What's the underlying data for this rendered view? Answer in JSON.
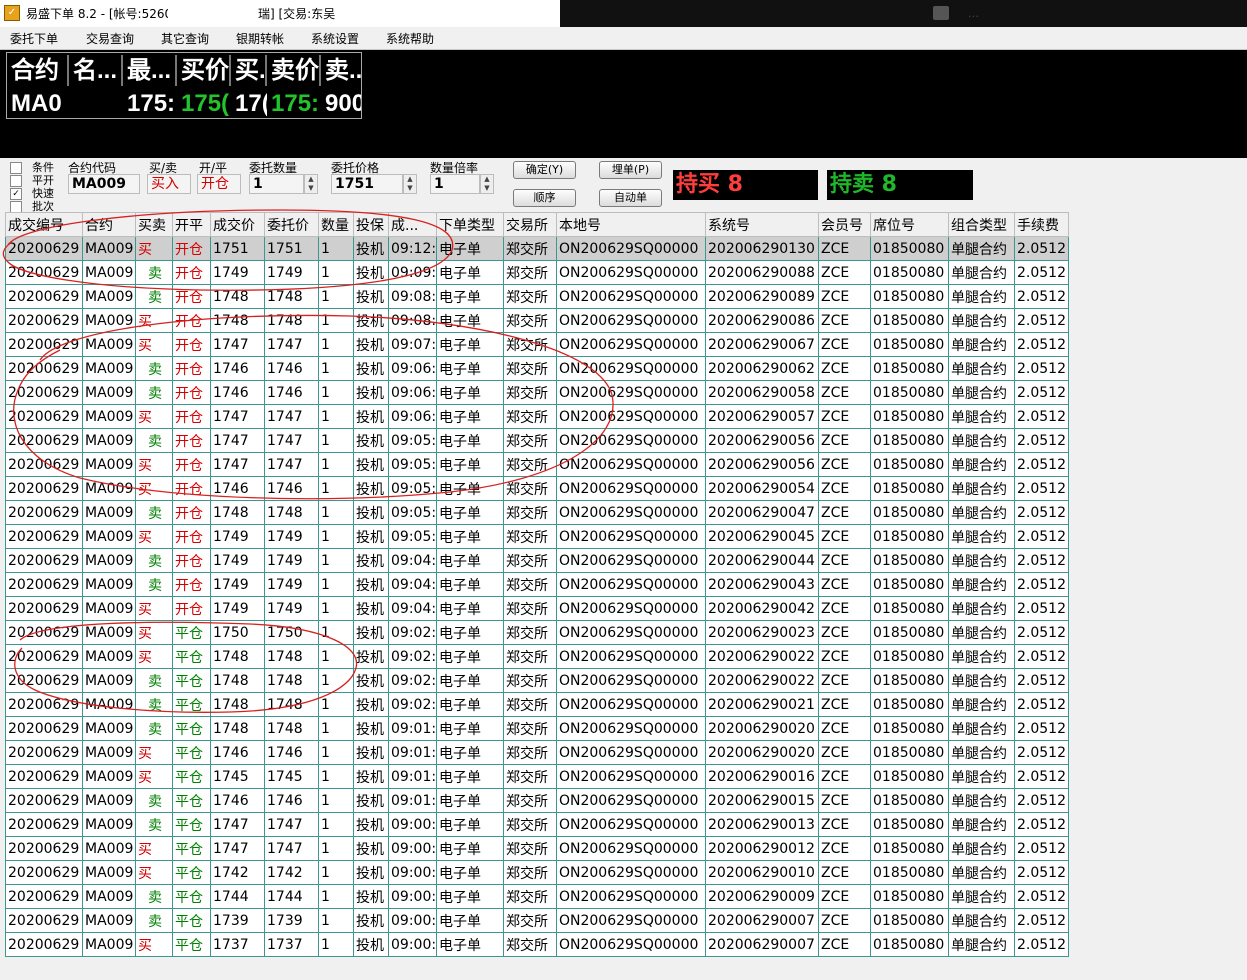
{
  "window": {
    "title_a": "易盛下单 8.2 - [帐号:5260",
    "title_b": "瑞] [交易:东吴",
    "right_text": "…"
  },
  "menu": [
    "委托下单",
    "交易查询",
    "其它查询",
    "银期转帐",
    "系统设置",
    "系统帮助"
  ],
  "quote": {
    "headers": [
      "合约",
      "名...",
      "最...",
      "买价",
      "买..",
      "卖价",
      "卖..."
    ],
    "values": [
      "MA0",
      "",
      "175:",
      "175(",
      "17(",
      "175:",
      "900"
    ]
  },
  "order_form": {
    "checkboxes": [
      {
        "label": "条件",
        "checked": false
      },
      {
        "label": "平开",
        "checked": false
      },
      {
        "label": "快速",
        "checked": true
      },
      {
        "label": "批次",
        "checked": false
      }
    ],
    "contract_label": "合约代码",
    "contract_value": "MA009",
    "side_label": "买/卖",
    "side_value": "买入",
    "oc_label": "开/平",
    "oc_value": "开仓",
    "qty_label": "委托数量",
    "qty_value": "1",
    "price_label": "委托价格",
    "price_value": "1751",
    "mult_label": "数量倍率",
    "mult_value": "1",
    "confirm_button": "确定(Y)",
    "sequence_button": "顺序",
    "park_button": "埋单(P)",
    "auto_button": "自动单",
    "hold_buy": "持买 8",
    "hold_sell": "持卖 8"
  },
  "table": {
    "headers": [
      "成交编号",
      "合约",
      "买卖",
      "开平",
      "成交价",
      "委托价",
      "数量",
      "投保",
      "成...",
      "下单类型",
      "交易所",
      "本地号",
      "系统号",
      "会员号",
      "席位号",
      "组合类型",
      "手续费"
    ],
    "rows": [
      [
        "20200629",
        "MA009",
        "买",
        "开仓",
        "1751",
        "1751",
        "1",
        "投机",
        "09:12:",
        "电子单",
        "郑交所",
        "ON200629SQ00000",
        "202006290130",
        "ZCE",
        "01850080",
        "单腿合约",
        "2.0512"
      ],
      [
        "20200629",
        "MA009",
        "卖",
        "开仓",
        "1749",
        "1749",
        "1",
        "投机",
        "09:09:",
        "电子单",
        "郑交所",
        "ON200629SQ00000",
        "202006290088",
        "ZCE",
        "01850080",
        "单腿合约",
        "2.0512"
      ],
      [
        "20200629",
        "MA009",
        "卖",
        "开仓",
        "1748",
        "1748",
        "1",
        "投机",
        "09:08:",
        "电子单",
        "郑交所",
        "ON200629SQ00000",
        "202006290089",
        "ZCE",
        "01850080",
        "单腿合约",
        "2.0512"
      ],
      [
        "20200629",
        "MA009",
        "买",
        "开仓",
        "1748",
        "1748",
        "1",
        "投机",
        "09:08:",
        "电子单",
        "郑交所",
        "ON200629SQ00000",
        "202006290086",
        "ZCE",
        "01850080",
        "单腿合约",
        "2.0512"
      ],
      [
        "20200629",
        "MA009",
        "买",
        "开仓",
        "1747",
        "1747",
        "1",
        "投机",
        "09:07:",
        "电子单",
        "郑交所",
        "ON200629SQ00000",
        "202006290067",
        "ZCE",
        "01850080",
        "单腿合约",
        "2.0512"
      ],
      [
        "20200629",
        "MA009",
        "卖",
        "开仓",
        "1746",
        "1746",
        "1",
        "投机",
        "09:06:",
        "电子单",
        "郑交所",
        "ON200629SQ00000",
        "202006290062",
        "ZCE",
        "01850080",
        "单腿合约",
        "2.0512"
      ],
      [
        "20200629",
        "MA009",
        "卖",
        "开仓",
        "1746",
        "1746",
        "1",
        "投机",
        "09:06:",
        "电子单",
        "郑交所",
        "ON200629SQ00000",
        "202006290058",
        "ZCE",
        "01850080",
        "单腿合约",
        "2.0512"
      ],
      [
        "20200629",
        "MA009",
        "买",
        "开仓",
        "1747",
        "1747",
        "1",
        "投机",
        "09:06:",
        "电子单",
        "郑交所",
        "ON200629SQ00000",
        "202006290057",
        "ZCE",
        "01850080",
        "单腿合约",
        "2.0512"
      ],
      [
        "20200629",
        "MA009",
        "卖",
        "开仓",
        "1747",
        "1747",
        "1",
        "投机",
        "09:05:",
        "电子单",
        "郑交所",
        "ON200629SQ00000",
        "202006290056",
        "ZCE",
        "01850080",
        "单腿合约",
        "2.0512"
      ],
      [
        "20200629",
        "MA009",
        "买",
        "开仓",
        "1747",
        "1747",
        "1",
        "投机",
        "09:05:",
        "电子单",
        "郑交所",
        "ON200629SQ00000",
        "202006290056",
        "ZCE",
        "01850080",
        "单腿合约",
        "2.0512"
      ],
      [
        "20200629",
        "MA009",
        "买",
        "开仓",
        "1746",
        "1746",
        "1",
        "投机",
        "09:05:",
        "电子单",
        "郑交所",
        "ON200629SQ00000",
        "202006290054",
        "ZCE",
        "01850080",
        "单腿合约",
        "2.0512"
      ],
      [
        "20200629",
        "MA009",
        "卖",
        "开仓",
        "1748",
        "1748",
        "1",
        "投机",
        "09:05:",
        "电子单",
        "郑交所",
        "ON200629SQ00000",
        "202006290047",
        "ZCE",
        "01850080",
        "单腿合约",
        "2.0512"
      ],
      [
        "20200629",
        "MA009",
        "买",
        "开仓",
        "1749",
        "1749",
        "1",
        "投机",
        "09:05:",
        "电子单",
        "郑交所",
        "ON200629SQ00000",
        "202006290045",
        "ZCE",
        "01850080",
        "单腿合约",
        "2.0512"
      ],
      [
        "20200629",
        "MA009",
        "卖",
        "开仓",
        "1749",
        "1749",
        "1",
        "投机",
        "09:04:",
        "电子单",
        "郑交所",
        "ON200629SQ00000",
        "202006290044",
        "ZCE",
        "01850080",
        "单腿合约",
        "2.0512"
      ],
      [
        "20200629",
        "MA009",
        "卖",
        "开仓",
        "1749",
        "1749",
        "1",
        "投机",
        "09:04:",
        "电子单",
        "郑交所",
        "ON200629SQ00000",
        "202006290043",
        "ZCE",
        "01850080",
        "单腿合约",
        "2.0512"
      ],
      [
        "20200629",
        "MA009",
        "买",
        "开仓",
        "1749",
        "1749",
        "1",
        "投机",
        "09:04:",
        "电子单",
        "郑交所",
        "ON200629SQ00000",
        "202006290042",
        "ZCE",
        "01850080",
        "单腿合约",
        "2.0512"
      ],
      [
        "20200629",
        "MA009",
        "买",
        "平仓",
        "1750",
        "1750",
        "1",
        "投机",
        "09:02:",
        "电子单",
        "郑交所",
        "ON200629SQ00000",
        "202006290023",
        "ZCE",
        "01850080",
        "单腿合约",
        "2.0512"
      ],
      [
        "20200629",
        "MA009",
        "买",
        "平仓",
        "1748",
        "1748",
        "1",
        "投机",
        "09:02:",
        "电子单",
        "郑交所",
        "ON200629SQ00000",
        "202006290022",
        "ZCE",
        "01850080",
        "单腿合约",
        "2.0512"
      ],
      [
        "20200629",
        "MA009",
        "卖",
        "平仓",
        "1748",
        "1748",
        "1",
        "投机",
        "09:02:",
        "电子单",
        "郑交所",
        "ON200629SQ00000",
        "202006290022",
        "ZCE",
        "01850080",
        "单腿合约",
        "2.0512"
      ],
      [
        "20200629",
        "MA009",
        "卖",
        "平仓",
        "1748",
        "1748",
        "1",
        "投机",
        "09:02:",
        "电子单",
        "郑交所",
        "ON200629SQ00000",
        "202006290021",
        "ZCE",
        "01850080",
        "单腿合约",
        "2.0512"
      ],
      [
        "20200629",
        "MA009",
        "卖",
        "平仓",
        "1748",
        "1748",
        "1",
        "投机",
        "09:01:",
        "电子单",
        "郑交所",
        "ON200629SQ00000",
        "202006290020",
        "ZCE",
        "01850080",
        "单腿合约",
        "2.0512"
      ],
      [
        "20200629",
        "MA009",
        "买",
        "平仓",
        "1746",
        "1746",
        "1",
        "投机",
        "09:01:",
        "电子单",
        "郑交所",
        "ON200629SQ00000",
        "202006290020",
        "ZCE",
        "01850080",
        "单腿合约",
        "2.0512"
      ],
      [
        "20200629",
        "MA009",
        "买",
        "平仓",
        "1745",
        "1745",
        "1",
        "投机",
        "09:01:",
        "电子单",
        "郑交所",
        "ON200629SQ00000",
        "202006290016",
        "ZCE",
        "01850080",
        "单腿合约",
        "2.0512"
      ],
      [
        "20200629",
        "MA009",
        "卖",
        "平仓",
        "1746",
        "1746",
        "1",
        "投机",
        "09:01:",
        "电子单",
        "郑交所",
        "ON200629SQ00000",
        "202006290015",
        "ZCE",
        "01850080",
        "单腿合约",
        "2.0512"
      ],
      [
        "20200629",
        "MA009",
        "卖",
        "平仓",
        "1747",
        "1747",
        "1",
        "投机",
        "09:00:",
        "电子单",
        "郑交所",
        "ON200629SQ00000",
        "202006290013",
        "ZCE",
        "01850080",
        "单腿合约",
        "2.0512"
      ],
      [
        "20200629",
        "MA009",
        "买",
        "平仓",
        "1747",
        "1747",
        "1",
        "投机",
        "09:00:",
        "电子单",
        "郑交所",
        "ON200629SQ00000",
        "202006290012",
        "ZCE",
        "01850080",
        "单腿合约",
        "2.0512"
      ],
      [
        "20200629",
        "MA009",
        "买",
        "平仓",
        "1742",
        "1742",
        "1",
        "投机",
        "09:00:",
        "电子单",
        "郑交所",
        "ON200629SQ00000",
        "202006290010",
        "ZCE",
        "01850080",
        "单腿合约",
        "2.0512"
      ],
      [
        "20200629",
        "MA009",
        "卖",
        "平仓",
        "1744",
        "1744",
        "1",
        "投机",
        "09:00:",
        "电子单",
        "郑交所",
        "ON200629SQ00000",
        "202006290009",
        "ZCE",
        "01850080",
        "单腿合约",
        "2.0512"
      ],
      [
        "20200629",
        "MA009",
        "卖",
        "平仓",
        "1739",
        "1739",
        "1",
        "投机",
        "09:00:",
        "电子单",
        "郑交所",
        "ON200629SQ00000",
        "202006290007",
        "ZCE",
        "01850080",
        "单腿合约",
        "2.0512"
      ],
      [
        "20200629",
        "MA009",
        "买",
        "平仓",
        "1737",
        "1737",
        "1",
        "投机",
        "09:00:",
        "电子单",
        "郑交所",
        "ON200629SQ00000",
        "202006290007",
        "ZCE",
        "01850080",
        "单腿合约",
        "2.0512"
      ]
    ]
  },
  "colors": {
    "buy": "#d40000",
    "sell": "#008000",
    "grid_line": "#3e9690",
    "quote_bg": "#000000",
    "annotation": "#d8211f"
  }
}
